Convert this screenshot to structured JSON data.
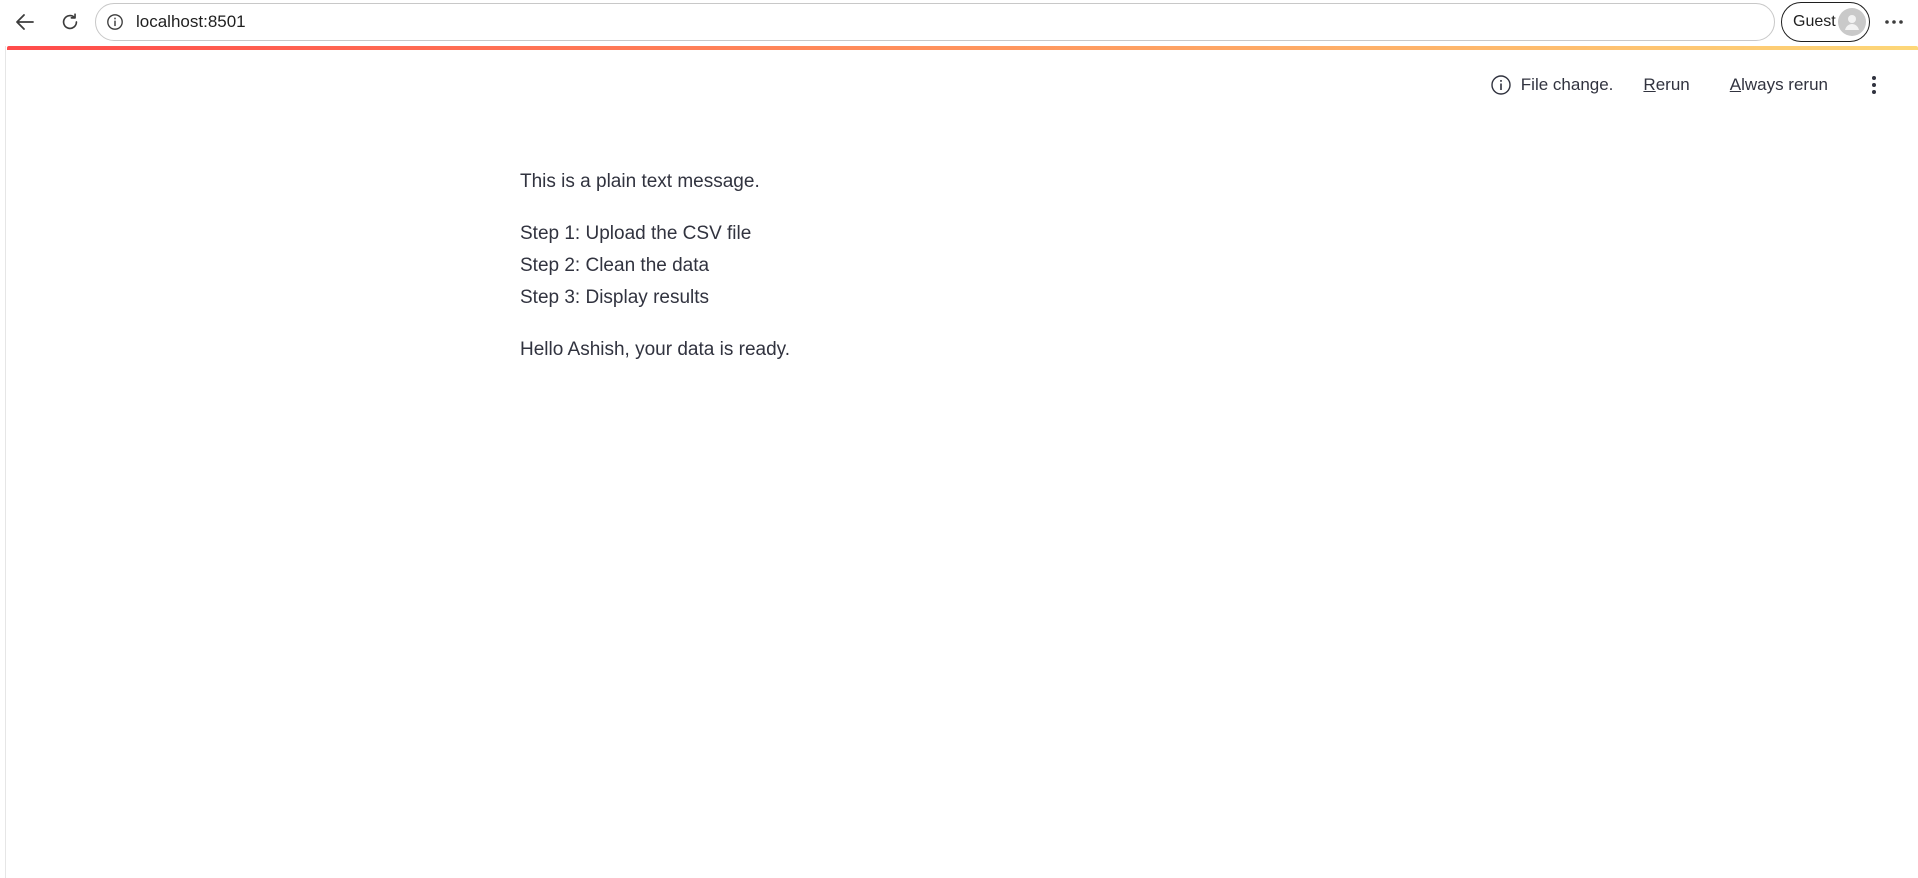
{
  "browser": {
    "url": "localhost:8501",
    "profile_label": "Guest"
  },
  "toolbar": {
    "status_text": "File change.",
    "rerun_access_key": "R",
    "rerun_rest": "erun",
    "always_access_key": "A",
    "always_rest": "lways rerun"
  },
  "main": {
    "plain_text": "This is a plain text message.",
    "steps": [
      "Step 1: Upload the CSV file",
      "Step 2: Clean the data",
      "Step 3: Display results"
    ],
    "greeting": "Hello Ashish, your data is ready."
  },
  "colors": {
    "gradient_start": "#ff4b4b",
    "gradient_end": "#fdd778",
    "text": "#31333f"
  }
}
